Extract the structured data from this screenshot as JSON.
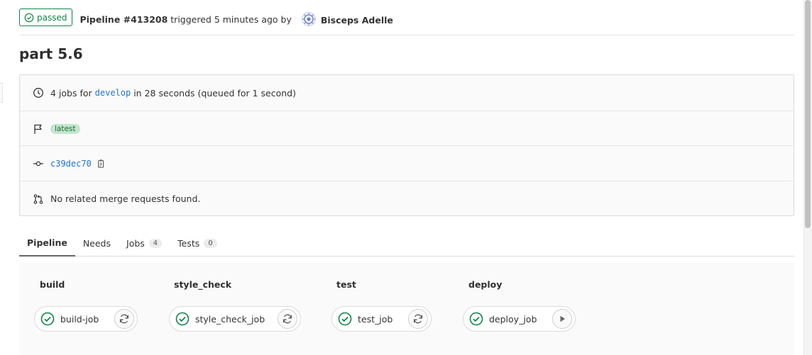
{
  "header": {
    "status_label": "passed",
    "pipeline_label": "Pipeline #413208",
    "triggered_text": " triggered 5 minutes ago by ",
    "author": "Bisceps Adelle"
  },
  "title": "part 5.6",
  "info": {
    "jobs_prefix": "4 jobs for ",
    "branch": "develop",
    "jobs_suffix": " in 28 seconds (queued for 1 second)",
    "tag": "latest",
    "commit": "c39dec70",
    "merge_text": "No related merge requests found."
  },
  "tabs": [
    {
      "label": "Pipeline",
      "count": null
    },
    {
      "label": "Needs",
      "count": null
    },
    {
      "label": "Jobs",
      "count": "4"
    },
    {
      "label": "Tests",
      "count": "0"
    }
  ],
  "stages": [
    {
      "name": "build",
      "job": "build-job",
      "action": "retry-icon"
    },
    {
      "name": "style_check",
      "job": "style_check_job",
      "action": "retry-icon"
    },
    {
      "name": "test",
      "job": "test_job",
      "action": "retry-icon"
    },
    {
      "name": "deploy",
      "job": "deploy_job",
      "action": "play-icon"
    }
  ],
  "colors": {
    "success": "#108548",
    "link": "#1f75cb",
    "tag_bg": "#c3e6cd"
  }
}
